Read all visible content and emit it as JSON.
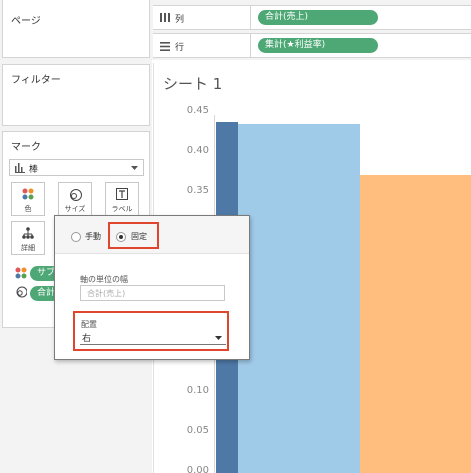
{
  "left_panel": {
    "pages_title": "ページ",
    "filters_title": "フィルター",
    "marks_title": "マーク",
    "mark_type": "棒",
    "mark_buttons": {
      "color": "色",
      "size": "サイズ",
      "label": "ラベル",
      "detail": "詳細"
    },
    "mark_fields": [
      "サブ",
      "合計"
    ]
  },
  "shelves": {
    "columns_label": "列",
    "columns_pill": "合計(売上)",
    "rows_label": "行",
    "rows_pill": "集計(★利益率)"
  },
  "sheet": {
    "title": "シート 1"
  },
  "chart_data": {
    "type": "bar",
    "title": "シート 1",
    "y_ticks": [
      "0.45",
      "0.40",
      "0.35",
      "0.10",
      "0.05",
      "0.00"
    ],
    "ylim": [
      0,
      0.45
    ],
    "colors": [
      "#4e79a7",
      "#a0cbe8",
      "#ffbe7d"
    ],
    "series": [
      {
        "values": [
          0.437
        ]
      },
      {
        "values": [
          0.435
        ]
      },
      {
        "values": [
          0.371
        ]
      }
    ]
  },
  "popup": {
    "radio_manual": "手動",
    "radio_fixed": "固定",
    "selected": "fixed",
    "axis_unit_label": "軸の単位の幅",
    "axis_unit_placeholder": "合計(売上)",
    "alignment_label": "配置",
    "alignment_value": "右"
  },
  "colors": {
    "pill_green": "#4ea876",
    "highlight_red": "#e0452e"
  }
}
